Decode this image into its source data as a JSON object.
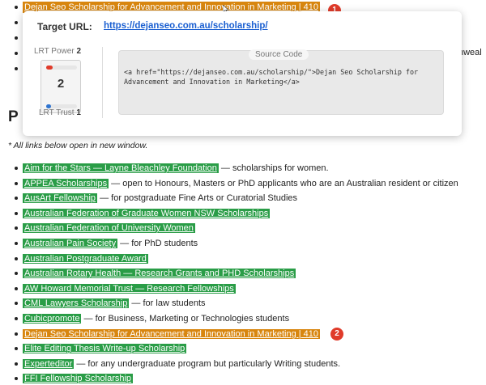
{
  "top_link": {
    "text": "Dejan Seo Scholarship for Advancement and Innovation in Marketing | 410",
    "badge": "1"
  },
  "popup": {
    "target_label": "Target URL:",
    "target_url": "https://dejanseo.com.au/scholarship/",
    "lrt_power_label": "LRT Power",
    "lrt_power_value": "2",
    "lrt_score": "2",
    "lrt_trust_label": "LRT Trust",
    "lrt_trust_value": "1",
    "source_code_title": "Source Code",
    "source_code": "<a href=\"https://dejanseo.com.au/scholarship/\">Dejan Seo Scholarship for Advancement and Innovation in Marketing</a>"
  },
  "background_fragments": {
    "heading_stub": "P",
    "truncated_right": "nweal"
  },
  "note": "* All links below open in new window.",
  "links": [
    {
      "link": "Aim for the Stars — Layne Bleachley Foundation",
      "rest": " — scholarships for women.",
      "color": "green"
    },
    {
      "link": "APPEA Scholarships",
      "rest": " — open to Honours, Masters or PhD applicants who are an Australian resident or citizen",
      "color": "green"
    },
    {
      "link": "AusArt Fellowship",
      "rest": " — for postgraduate Fine Arts or Curatorial Studies",
      "color": "green"
    },
    {
      "link": "Australian Federation of Graduate Women NSW Scholarships",
      "rest": "",
      "color": "green"
    },
    {
      "link": "Australian Federation of University Women",
      "rest": "",
      "color": "green"
    },
    {
      "link": "Australian Pain Society",
      "rest": " — for PhD students",
      "color": "green"
    },
    {
      "link": "Australian Postgraduate Award",
      "rest": "",
      "color": "green"
    },
    {
      "link": "Australian Rotary Health — Research Grants and PHD Scholarships",
      "rest": "",
      "color": "green"
    },
    {
      "link": "AW Howard Memorial Trust — Research Fellowships",
      "rest": "",
      "color": "green"
    },
    {
      "link": "CML Lawyers Scholarship",
      "rest": " — for law students",
      "color": "green"
    },
    {
      "link": "Cubicpromote",
      "rest": " — for Business, Marketing or Technologies students",
      "color": "green"
    },
    {
      "link": "Dejan Seo Scholarship for Advancement and Innovation in Marketing | 410",
      "rest": "",
      "color": "orange",
      "badge": "2"
    },
    {
      "link": "Elite Editing Thesis Write-up Scholarship",
      "rest": "",
      "color": "green"
    },
    {
      "link": "Experteditor",
      "rest": " — for any undergraduate program but particularly Writing students.",
      "color": "green"
    },
    {
      "link": "FFI Fellowship Scholarship",
      "rest": "",
      "color": "green"
    }
  ],
  "colors": {
    "green_highlight": "#2a9d47",
    "orange_highlight": "#d8860f",
    "badge": "#e03b2a",
    "url": "#1a5fd1"
  }
}
